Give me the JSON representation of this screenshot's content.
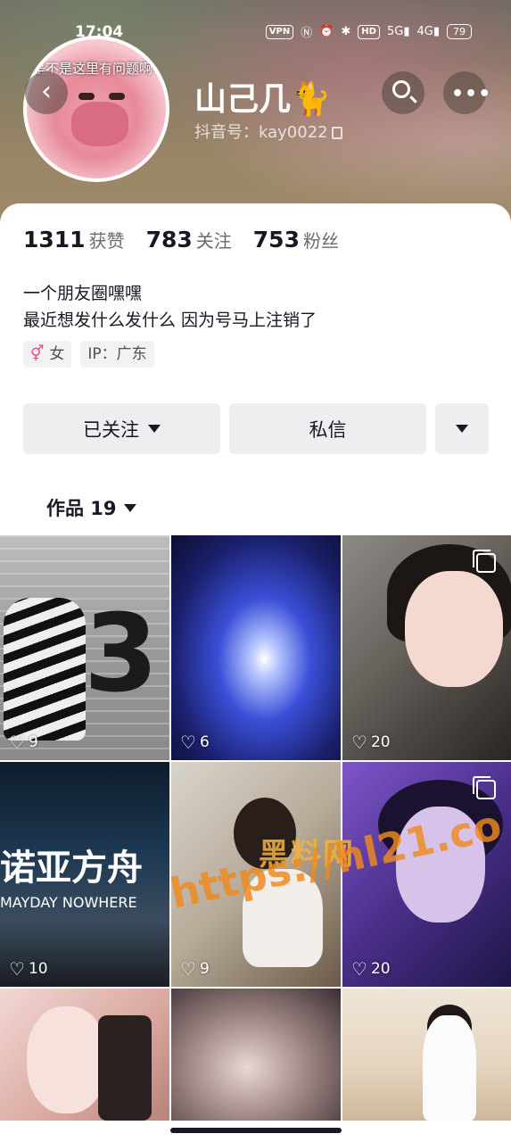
{
  "status_bar": {
    "time": "17:04",
    "vpn": "VPN",
    "hd": "HD",
    "signal_5g": "5G",
    "signal_4g": "4G",
    "battery": "79"
  },
  "profile": {
    "avatar_caption": "是不是这里有问题啊",
    "nickname": "山己几",
    "nickname_emoji": "🐈",
    "douyin_id": "抖音号：kay0022"
  },
  "stats": [
    {
      "value": "1311",
      "label": "获赞"
    },
    {
      "value": "783",
      "label": "关注"
    },
    {
      "value": "753",
      "label": "粉丝"
    }
  ],
  "bio": {
    "line1": "一个朋友圈嘿嘿",
    "line2": "最近想发什么发什么 因为号马上注销了"
  },
  "tags": {
    "gender_symbol": "⚥",
    "gender": "女",
    "ip": "IP：广东"
  },
  "actions": {
    "follow_label": "已关注",
    "message_label": "私信"
  },
  "works_tab": {
    "label": "作品 19"
  },
  "works": [
    {
      "likes": "9",
      "text": "3"
    },
    {
      "likes": "6"
    },
    {
      "likes": "20"
    },
    {
      "likes": "10",
      "text": "诺亚方舟",
      "subtext": "MAYDAY  NOWHERE"
    },
    {
      "likes": "9"
    },
    {
      "likes": "20"
    },
    {},
    {},
    {}
  ],
  "watermark": {
    "title": "黑料网",
    "url": "https://hl21.co"
  },
  "colors": {
    "accent_pink": "#f0468c",
    "button_bg": "#eeeef0",
    "text_primary": "#161823",
    "watermark_orange": "#f08a1e"
  }
}
